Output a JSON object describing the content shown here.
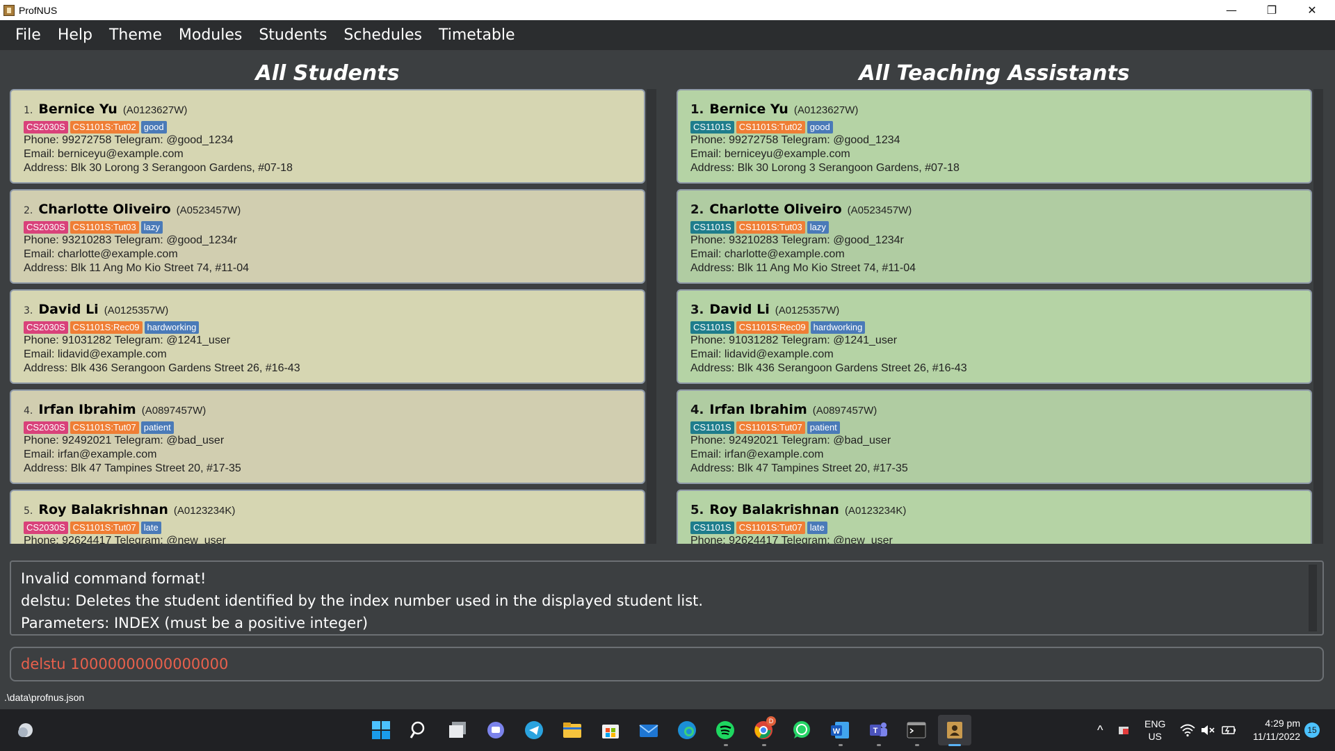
{
  "window": {
    "title": "ProfNUS",
    "minimize_glyph": "—",
    "maximize_glyph": "❐",
    "close_glyph": "✕"
  },
  "menu": [
    "File",
    "Help",
    "Theme",
    "Modules",
    "Students",
    "Schedules",
    "Timetable"
  ],
  "students_panel": {
    "title": "All Students",
    "items": [
      {
        "index": "1.",
        "name": "Bernice Yu",
        "id": "(A0123627W)",
        "tags": [
          "CS2030S",
          "CS1101S:Tut02",
          "good"
        ],
        "phone": "Phone: 99272758 Telegram: @good_1234",
        "email": "Email: berniceyu@example.com",
        "address": "Address: Blk 30 Lorong 3 Serangoon Gardens, #07-18"
      },
      {
        "index": "2.",
        "name": "Charlotte Oliveiro",
        "id": "(A0523457W)",
        "tags": [
          "CS2030S",
          "CS1101S:Tut03",
          "lazy"
        ],
        "phone": "Phone: 93210283 Telegram: @good_1234r",
        "email": "Email: charlotte@example.com",
        "address": "Address: Blk 11 Ang Mo Kio Street 74, #11-04"
      },
      {
        "index": "3.",
        "name": "David Li",
        "id": "(A0125357W)",
        "tags": [
          "CS2030S",
          "CS1101S:Rec09",
          "hardworking"
        ],
        "phone": "Phone: 91031282 Telegram: @1241_user",
        "email": "Email: lidavid@example.com",
        "address": "Address: Blk 436 Serangoon Gardens Street 26, #16-43"
      },
      {
        "index": "4.",
        "name": "Irfan Ibrahim",
        "id": "(A0897457W)",
        "tags": [
          "CS2030S",
          "CS1101S:Tut07",
          "patient"
        ],
        "phone": "Phone: 92492021 Telegram: @bad_user",
        "email": "Email: irfan@example.com",
        "address": "Address: Blk 47 Tampines Street 20, #17-35"
      },
      {
        "index": "5.",
        "name": "Roy Balakrishnan",
        "id": "(A0123234K)",
        "tags": [
          "CS2030S",
          "CS1101S:Tut07",
          "late"
        ],
        "phone": "Phone: 92624417 Telegram: @new_user",
        "email": "",
        "address": ""
      }
    ]
  },
  "tas_panel": {
    "title": "All Teaching Assistants",
    "items": [
      {
        "index": "1.",
        "name": "Bernice Yu",
        "id": "(A0123627W)",
        "tags": [
          "CS1101S",
          "CS1101S:Tut02",
          "good"
        ],
        "phone": "Phone: 99272758 Telegram: @good_1234",
        "email": "Email: berniceyu@example.com",
        "address": "Address: Blk 30 Lorong 3 Serangoon Gardens, #07-18"
      },
      {
        "index": "2.",
        "name": "Charlotte Oliveiro",
        "id": "(A0523457W)",
        "tags": [
          "CS1101S",
          "CS1101S:Tut03",
          "lazy"
        ],
        "phone": "Phone: 93210283 Telegram: @good_1234r",
        "email": "Email: charlotte@example.com",
        "address": "Address: Blk 11 Ang Mo Kio Street 74, #11-04"
      },
      {
        "index": "3.",
        "name": "David Li",
        "id": "(A0125357W)",
        "tags": [
          "CS1101S",
          "CS1101S:Rec09",
          "hardworking"
        ],
        "phone": "Phone: 91031282 Telegram: @1241_user",
        "email": "Email: lidavid@example.com",
        "address": "Address: Blk 436 Serangoon Gardens Street 26, #16-43"
      },
      {
        "index": "4.",
        "name": "Irfan Ibrahim",
        "id": "(A0897457W)",
        "tags": [
          "CS1101S",
          "CS1101S:Tut07",
          "patient"
        ],
        "phone": "Phone: 92492021 Telegram: @bad_user",
        "email": "Email: irfan@example.com",
        "address": "Address: Blk 47 Tampines Street 20, #17-35"
      },
      {
        "index": "5.",
        "name": "Roy Balakrishnan",
        "id": "(A0123234K)",
        "tags": [
          "CS1101S",
          "CS1101S:Tut07",
          "late"
        ],
        "phone": "Phone: 92624417 Telegram: @new_user",
        "email": "",
        "address": ""
      }
    ]
  },
  "result": {
    "lines": [
      "Invalid command format!",
      "delstu: Deletes the student identified by the index number used in the displayed student list.",
      "Parameters: INDEX (must be a positive integer)"
    ]
  },
  "command": {
    "value": "delstu 10000000000000000"
  },
  "status": {
    "path": ".\\data\\profnus.json"
  },
  "taskbar": {
    "apps": [
      "weather-icon",
      "windows-start-icon",
      "search-icon",
      "task-view-icon",
      "teams-chat-icon",
      "telegram-icon",
      "file-explorer-icon",
      "microsoft-store-icon",
      "mail-icon",
      "edge-icon",
      "spotify-icon",
      "chrome-icon",
      "whatsapp-icon",
      "word-icon",
      "teams-icon",
      "terminal-icon",
      "profnus-app-icon"
    ],
    "chrome_badge": "D",
    "lang_top": "ENG",
    "lang_bottom": "US",
    "time": "4:29 pm",
    "date": "11/11/2022",
    "notification_count": "15"
  },
  "colors": {
    "module_tag_student": "#d9417a",
    "module_tag_ta": "#1f7d8c",
    "group_tag": "#ef7e35",
    "note_tag": "#4a7ab8",
    "command_text": "#e8604c"
  }
}
